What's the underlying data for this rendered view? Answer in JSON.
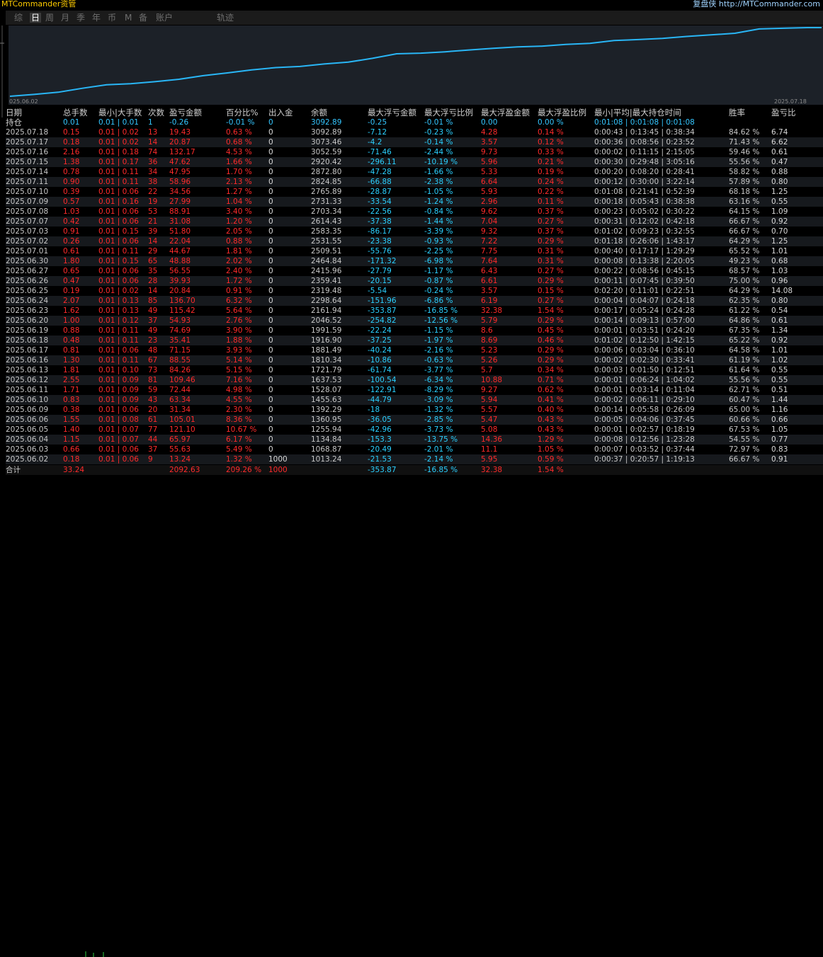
{
  "app": {
    "title": "MTCommander资管",
    "replay_label": "复盘侠 http://MTCommander.com"
  },
  "tabs": [
    {
      "label": "综",
      "active": false
    },
    {
      "label": "日",
      "active": true
    },
    {
      "label": "周",
      "active": false
    },
    {
      "label": "月",
      "active": false
    },
    {
      "label": "季",
      "active": false
    },
    {
      "label": "年",
      "active": false
    },
    {
      "label": "币",
      "active": false
    },
    {
      "label": "M",
      "active": false
    },
    {
      "label": "备",
      "active": false
    },
    {
      "label": "账户",
      "active": false
    },
    {
      "label": "轨迹",
      "active": false
    }
  ],
  "chart_data": {
    "type": "line",
    "x_start_label": "025.06.02",
    "x_end_label": "2025.07.18",
    "series": [
      {
        "color": "#29b6f6",
        "values": [
          1013.24,
          1068.87,
          1134.84,
          1255.94,
          1360.95,
          1392.29,
          1455.63,
          1528.07,
          1637.53,
          1721.79,
          1810.34,
          1881.49,
          1916.9,
          1991.59,
          2046.52,
          2161.94,
          2298.64,
          2319.48,
          2359.41,
          2415.96,
          2464.84,
          2509.51,
          2531.55,
          2583.35,
          2614.43,
          2703.34,
          2731.33,
          2765.89,
          2824.85,
          2872.8,
          2920.42,
          3052.59,
          3073.46,
          3092.89
        ]
      }
    ]
  },
  "table": {
    "headers": [
      "日期",
      "总手数",
      "最小|大手数",
      "次数",
      "盈亏金额",
      "百分比%",
      "出入金",
      "余额",
      "最大浮亏金额",
      "最大浮亏比例",
      "最大浮盈金额",
      "最大浮盈比例",
      "最小|平均|最大持仓时间",
      "胜率",
      "盈亏比"
    ],
    "holding": [
      "持仓",
      "0.01",
      "0.01 | 0.01",
      "1",
      "-0.26",
      "-0.01 %",
      "0",
      "3092.89",
      "-0.25",
      "-0.01 %",
      "0.00",
      "0.00 %",
      "0:01:08 | 0:01:08 | 0:01:08",
      "",
      ""
    ],
    "rows": [
      [
        "2025.07.18",
        "0.15",
        "0.01 | 0.02",
        "13",
        "19.43",
        "0.63 %",
        "0",
        "3092.89",
        "-7.12",
        "-0.23 %",
        "4.28",
        "0.14 %",
        "0:00:43 | 0:13:45 | 0:38:34",
        "84.62 %",
        "6.74"
      ],
      [
        "2025.07.17",
        "0.18",
        "0.01 | 0.02",
        "14",
        "20.87",
        "0.68 %",
        "0",
        "3073.46",
        "-4.2",
        "-0.14 %",
        "3.57",
        "0.12 %",
        "0:00:36 | 0:08:56 | 0:23:52",
        "71.43 %",
        "6.62"
      ],
      [
        "2025.07.16",
        "2.16",
        "0.01 | 0.18",
        "74",
        "132.17",
        "4.53 %",
        "0",
        "3052.59",
        "-71.46",
        "-2.44 %",
        "9.73",
        "0.33 %",
        "0:00:02 | 0:11:15 | 2:15:05",
        "59.46 %",
        "0.61"
      ],
      [
        "2025.07.15",
        "1.38",
        "0.01 | 0.17",
        "36",
        "47.62",
        "1.66 %",
        "0",
        "2920.42",
        "-296.11",
        "-10.19 %",
        "5.96",
        "0.21 %",
        "0:00:30 | 0:29:48 | 3:05:16",
        "55.56 %",
        "0.47"
      ],
      [
        "2025.07.14",
        "0.78",
        "0.01 | 0.11",
        "34",
        "47.95",
        "1.70 %",
        "0",
        "2872.80",
        "-47.28",
        "-1.66 %",
        "5.33",
        "0.19 %",
        "0:00:20 | 0:08:20 | 0:28:41",
        "58.82 %",
        "0.88"
      ],
      [
        "2025.07.11",
        "0.90",
        "0.01 | 0.11",
        "38",
        "58.96",
        "2.13 %",
        "0",
        "2824.85",
        "-66.88",
        "-2.38 %",
        "6.64",
        "0.24 %",
        "0:00:12 | 0:30:00 | 3:22:14",
        "57.89 %",
        "0.80"
      ],
      [
        "2025.07.10",
        "0.39",
        "0.01 | 0.06",
        "22",
        "34.56",
        "1.27 %",
        "0",
        "2765.89",
        "-28.87",
        "-1.05 %",
        "5.93",
        "0.22 %",
        "0:01:08 | 0:21:41 | 0:52:39",
        "68.18 %",
        "1.25"
      ],
      [
        "2025.07.09",
        "0.57",
        "0.01 | 0.16",
        "19",
        "27.99",
        "1.04 %",
        "0",
        "2731.33",
        "-33.54",
        "-1.24 %",
        "2.96",
        "0.11 %",
        "0:00:18 | 0:05:43 | 0:38:38",
        "63.16 %",
        "0.55"
      ],
      [
        "2025.07.08",
        "1.03",
        "0.01 | 0.06",
        "53",
        "88.91",
        "3.40 %",
        "0",
        "2703.34",
        "-22.56",
        "-0.84 %",
        "9.62",
        "0.37 %",
        "0:00:23 | 0:05:02 | 0:30:22",
        "64.15 %",
        "1.09"
      ],
      [
        "2025.07.07",
        "0.42",
        "0.01 | 0.06",
        "21",
        "31.08",
        "1.20 %",
        "0",
        "2614.43",
        "-37.38",
        "-1.44 %",
        "7.04",
        "0.27 %",
        "0:00:31 | 0:12:02 | 0:42:18",
        "66.67 %",
        "0.92"
      ],
      [
        "2025.07.03",
        "0.91",
        "0.01 | 0.15",
        "39",
        "51.80",
        "2.05 %",
        "0",
        "2583.35",
        "-86.17",
        "-3.39 %",
        "9.32",
        "0.37 %",
        "0:01:02 | 0:09:23 | 0:32:55",
        "66.67 %",
        "0.70"
      ],
      [
        "2025.07.02",
        "0.26",
        "0.01 | 0.06",
        "14",
        "22.04",
        "0.88 %",
        "0",
        "2531.55",
        "-23.38",
        "-0.93 %",
        "7.22",
        "0.29 %",
        "0:01:18 | 0:26:06 | 1:43:17",
        "64.29 %",
        "1.25"
      ],
      [
        "2025.07.01",
        "0.61",
        "0.01 | 0.11",
        "29",
        "44.67",
        "1.81 %",
        "0",
        "2509.51",
        "-55.76",
        "-2.25 %",
        "7.75",
        "0.31 %",
        "0:00:40 | 0:17:17 | 1:29:29",
        "65.52 %",
        "1.01"
      ],
      [
        "2025.06.30",
        "1.80",
        "0.01 | 0.15",
        "65",
        "48.88",
        "2.02 %",
        "0",
        "2464.84",
        "-171.32",
        "-6.98 %",
        "7.64",
        "0.31 %",
        "0:00:08 | 0:13:38 | 2:20:05",
        "49.23 %",
        "0.68"
      ],
      [
        "2025.06.27",
        "0.65",
        "0.01 | 0.06",
        "35",
        "56.55",
        "2.40 %",
        "0",
        "2415.96",
        "-27.79",
        "-1.17 %",
        "6.43",
        "0.27 %",
        "0:00:22 | 0:08:56 | 0:45:15",
        "68.57 %",
        "1.03"
      ],
      [
        "2025.06.26",
        "0.47",
        "0.01 | 0.06",
        "28",
        "39.93",
        "1.72 %",
        "0",
        "2359.41",
        "-20.15",
        "-0.87 %",
        "6.61",
        "0.29 %",
        "0:00:11 | 0:07:45 | 0:39:50",
        "75.00 %",
        "0.96"
      ],
      [
        "2025.06.25",
        "0.19",
        "0.01 | 0.02",
        "14",
        "20.84",
        "0.91 %",
        "0",
        "2319.48",
        "-5.54",
        "-0.24 %",
        "3.57",
        "0.15 %",
        "0:02:20 | 0:11:01 | 0:22:51",
        "64.29 %",
        "14.08"
      ],
      [
        "2025.06.24",
        "2.07",
        "0.01 | 0.13",
        "85",
        "136.70",
        "6.32 %",
        "0",
        "2298.64",
        "-151.96",
        "-6.86 %",
        "6.19",
        "0.27 %",
        "0:00:04 | 0:04:07 | 0:24:18",
        "62.35 %",
        "0.80"
      ],
      [
        "2025.06.23",
        "1.62",
        "0.01 | 0.13",
        "49",
        "115.42",
        "5.64 %",
        "0",
        "2161.94",
        "-353.87",
        "-16.85 %",
        "32.38",
        "1.54 %",
        "0:00:17 | 0:05:24 | 0:24:28",
        "61.22 %",
        "0.54"
      ],
      [
        "2025.06.20",
        "1.00",
        "0.01 | 0.12",
        "37",
        "54.93",
        "2.76 %",
        "0",
        "2046.52",
        "-254.82",
        "-12.56 %",
        "5.79",
        "0.29 %",
        "0:00:14 | 0:09:13 | 0:57:00",
        "64.86 %",
        "0.61"
      ],
      [
        "2025.06.19",
        "0.88",
        "0.01 | 0.11",
        "49",
        "74.69",
        "3.90 %",
        "0",
        "1991.59",
        "-22.24",
        "-1.15 %",
        "8.6",
        "0.45 %",
        "0:00:01 | 0:03:51 | 0:24:20",
        "67.35 %",
        "1.34"
      ],
      [
        "2025.06.18",
        "0.48",
        "0.01 | 0.11",
        "23",
        "35.41",
        "1.88 %",
        "0",
        "1916.90",
        "-37.25",
        "-1.97 %",
        "8.69",
        "0.46 %",
        "0:01:02 | 0:12:50 | 1:42:15",
        "65.22 %",
        "0.92"
      ],
      [
        "2025.06.17",
        "0.81",
        "0.01 | 0.06",
        "48",
        "71.15",
        "3.93 %",
        "0",
        "1881.49",
        "-40.24",
        "-2.16 %",
        "5.23",
        "0.29 %",
        "0:00:06 | 0:03:04 | 0:36:10",
        "64.58 %",
        "1.01"
      ],
      [
        "2025.06.16",
        "1.30",
        "0.01 | 0.11",
        "67",
        "88.55",
        "5.14 %",
        "0",
        "1810.34",
        "-10.86",
        "-0.63 %",
        "5.26",
        "0.29 %",
        "0:00:02 | 0:02:30 | 0:33:41",
        "61.19 %",
        "1.02"
      ],
      [
        "2025.06.13",
        "1.81",
        "0.01 | 0.10",
        "73",
        "84.26",
        "5.15 %",
        "0",
        "1721.79",
        "-61.74",
        "-3.77 %",
        "5.7",
        "0.34 %",
        "0:00:03 | 0:01:50 | 0:12:51",
        "61.64 %",
        "0.55"
      ],
      [
        "2025.06.12",
        "2.55",
        "0.01 | 0.09",
        "81",
        "109.46",
        "7.16 %",
        "0",
        "1637.53",
        "-100.54",
        "-6.34 %",
        "10.88",
        "0.71 %",
        "0:00:01 | 0:06:24 | 1:04:02",
        "55.56 %",
        "0.55"
      ],
      [
        "2025.06.11",
        "1.71",
        "0.01 | 0.09",
        "59",
        "72.44",
        "4.98 %",
        "0",
        "1528.07",
        "-122.91",
        "-8.29 %",
        "9.27",
        "0.62 %",
        "0:00:01 | 0:03:14 | 0:11:04",
        "62.71 %",
        "0.51"
      ],
      [
        "2025.06.10",
        "0.83",
        "0.01 | 0.09",
        "43",
        "63.34",
        "4.55 %",
        "0",
        "1455.63",
        "-44.79",
        "-3.09 %",
        "5.94",
        "0.41 %",
        "0:00:02 | 0:06:11 | 0:29:10",
        "60.47 %",
        "1.44"
      ],
      [
        "2025.06.09",
        "0.38",
        "0.01 | 0.06",
        "20",
        "31.34",
        "2.30 %",
        "0",
        "1392.29",
        "-18",
        "-1.32 %",
        "5.57",
        "0.40 %",
        "0:00:14 | 0:05:58 | 0:26:09",
        "65.00 %",
        "1.16"
      ],
      [
        "2025.06.06",
        "1.55",
        "0.01 | 0.08",
        "61",
        "105.01",
        "8.36 %",
        "0",
        "1360.95",
        "-36.05",
        "-2.85 %",
        "5.47",
        "0.43 %",
        "0:00:05 | 0:04:06 | 0:37:45",
        "60.66 %",
        "0.66"
      ],
      [
        "2025.06.05",
        "1.40",
        "0.01 | 0.07",
        "77",
        "121.10",
        "10.67 %",
        "0",
        "1255.94",
        "-42.96",
        "-3.73 %",
        "5.08",
        "0.43 %",
        "0:00:01 | 0:02:57 | 0:18:19",
        "67.53 %",
        "1.05"
      ],
      [
        "2025.06.04",
        "1.15",
        "0.01 | 0.07",
        "44",
        "65.97",
        "6.17 %",
        "0",
        "1134.84",
        "-153.3",
        "-13.75 %",
        "14.36",
        "1.29 %",
        "0:00:08 | 0:12:56 | 1:23:28",
        "54.55 %",
        "0.77"
      ],
      [
        "2025.06.03",
        "0.66",
        "0.01 | 0.06",
        "37",
        "55.63",
        "5.49 %",
        "0",
        "1068.87",
        "-20.49",
        "-2.01 %",
        "11.1",
        "1.05 %",
        "0:00:07 | 0:03:52 | 0:37:44",
        "72.97 %",
        "0.83"
      ],
      [
        "2025.06.02",
        "0.18",
        "0.01 | 0.06",
        "9",
        "13.24",
        "1.32 %",
        "1000",
        "1013.24",
        "-21.53",
        "-2.14 %",
        "5.95",
        "0.59 %",
        "0:00:37 | 0:20:57 | 1:19:13",
        "66.67 %",
        "0.91"
      ]
    ],
    "total": [
      "合计",
      "33.24",
      "",
      "",
      "2092.63",
      "209.26 %",
      "1000",
      "",
      "-353.87",
      "-16.85 %",
      "32.38",
      "1.54 %",
      "",
      "",
      ""
    ]
  }
}
